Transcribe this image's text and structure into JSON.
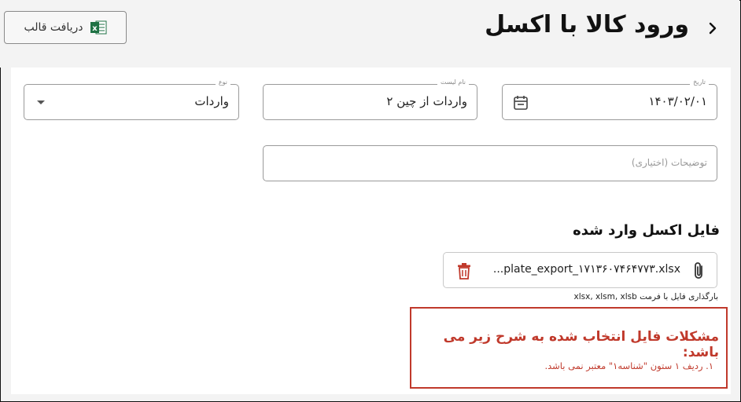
{
  "header": {
    "title": "ورود کالا با اکسل",
    "template_button_label": "دریافت قالب"
  },
  "form": {
    "date": {
      "legend": "تاریخ",
      "value": "۱۴۰۳/۰۲/۰۱"
    },
    "list_name": {
      "legend": "نام لیست",
      "value": "واردات از چین ۲"
    },
    "type": {
      "legend": "نوع",
      "value": "واردات"
    },
    "description": {
      "placeholder": "توضیحات (اختیاری)"
    }
  },
  "upload": {
    "section_title": "فایل اکسل وارد شده",
    "file_name": "...plate_export_۱۷۱۳۶۰۷۴۶۴۷۷۳.xlsx",
    "format_hint": "بارگذاری فایل با فرمت xlsx, xlsm, xlsb"
  },
  "errors": {
    "title": "مشکلات فایل انتخاب شده به شرح زیر می باشد:",
    "items": [
      "۱. ردیف ۱ ستون \"شناسه۱\" معتبر نمی باشد."
    ]
  },
  "colors": {
    "error": "#c0392b",
    "excel": "#1f7244"
  }
}
